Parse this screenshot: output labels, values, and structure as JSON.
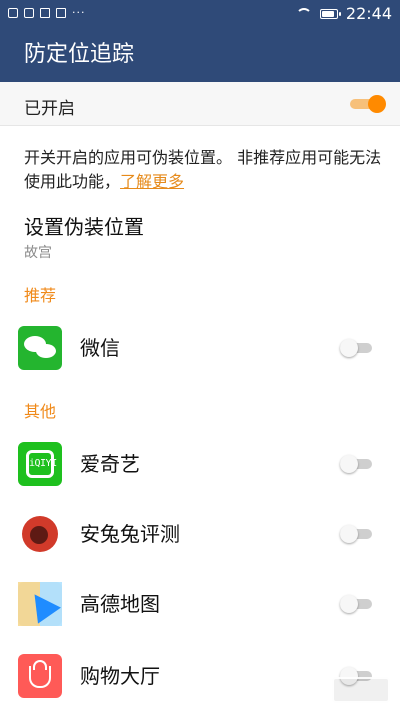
{
  "status": {
    "time": "22:44",
    "notification_dots": "···"
  },
  "appbar": {
    "title": "防定位追踪"
  },
  "master": {
    "label": "已开启",
    "enabled": true
  },
  "description": {
    "text": "开关开启的应用可伪装位置。 非推荐应用可能无法使用此功能，",
    "link": "了解更多"
  },
  "set_location": {
    "title": "设置伪装位置",
    "value": "故宫"
  },
  "sections": {
    "recommended": "推荐",
    "other": "其他"
  },
  "apps": [
    {
      "name": "微信",
      "icon": "wechat-icon",
      "enabled": false
    },
    {
      "name": "爱奇艺",
      "icon": "iqiyi-icon",
      "enabled": false
    },
    {
      "name": "安兔兔评测",
      "icon": "antutu-icon",
      "enabled": false
    },
    {
      "name": "高德地图",
      "icon": "amap-icon",
      "enabled": false
    },
    {
      "name": "购物大厅",
      "icon": "shopping-bag-icon",
      "enabled": false
    }
  ],
  "colors": {
    "primary": "#2f4a78",
    "accent": "#ff8a00",
    "link": "#e68a1a",
    "section": "#f08a1a"
  }
}
